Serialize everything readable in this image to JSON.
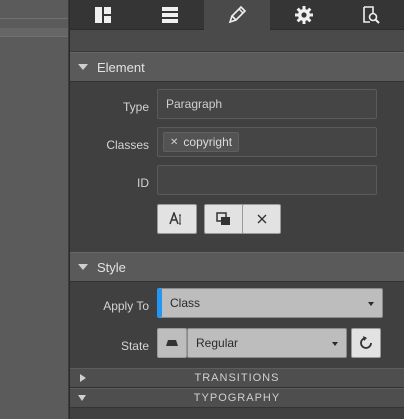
{
  "toolbar": {
    "tabs": [
      {
        "icon": "layout-grid-icon"
      },
      {
        "icon": "list-rows-icon"
      },
      {
        "icon": "brush-icon",
        "active": true
      },
      {
        "icon": "gear-icon"
      },
      {
        "icon": "page-search-icon"
      }
    ]
  },
  "element_section": {
    "title": "Element",
    "type_label": "Type",
    "type_value": "Paragraph",
    "classes_label": "Classes",
    "classes": [
      "copyright"
    ],
    "id_label": "ID",
    "id_value": "",
    "actions": [
      "text-cursor-icon",
      "duplicate-icon",
      "close-icon"
    ]
  },
  "style_section": {
    "title": "Style",
    "apply_to_label": "Apply To",
    "apply_to_value": "Class",
    "state_label": "State",
    "state_value": "Regular",
    "accent_color": "#2196f3"
  },
  "collapsibles": [
    {
      "label": "TRANSITIONS",
      "expanded": false
    },
    {
      "label": "TYPOGRAPHY",
      "expanded": true
    }
  ]
}
